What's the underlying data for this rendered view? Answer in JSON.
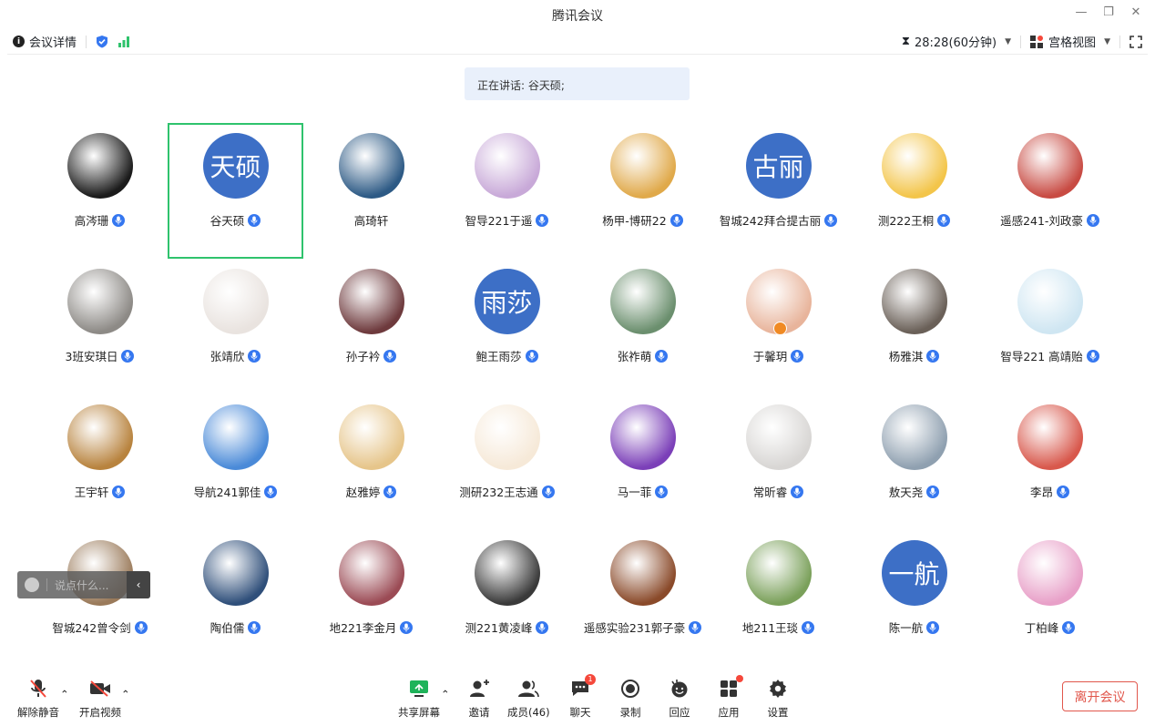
{
  "window": {
    "title": "腾讯会议"
  },
  "infobar": {
    "meeting_info": "会议详情",
    "timer": "28:28(60分钟)",
    "view": "宫格视图"
  },
  "speaking": "正在讲话: 谷天硕;",
  "participants": [
    {
      "name": "高涔珊",
      "bg": "#1b1b1b",
      "mic": true
    },
    {
      "name": "谷天硕",
      "avatar_text": "天硕",
      "mic": true,
      "active": true
    },
    {
      "name": "高琦轩",
      "bg": "#2d5a85",
      "mic": false
    },
    {
      "name": "智导221于遥",
      "bg": "#c8a9d8",
      "mic": true
    },
    {
      "name": "杨甲-博研22",
      "bg": "#e0a94a",
      "mic": true
    },
    {
      "name": "智城242拜合提古丽",
      "avatar_text": "古丽",
      "mic": true
    },
    {
      "name": "测222王桐",
      "bg": "#f3c54a",
      "mic": true
    },
    {
      "name": "遥感241-刘政豪",
      "bg": "#c84b43",
      "mic": true
    },
    {
      "name": "3班安琪日",
      "bg": "#8d8a86",
      "mic": true
    },
    {
      "name": "张靖欣",
      "bg": "#e9e3df",
      "mic": true
    },
    {
      "name": "孙子衿",
      "bg": "#6e3a3d",
      "mic": true
    },
    {
      "name": "鲍王雨莎",
      "avatar_text": "雨莎",
      "mic": true
    },
    {
      "name": "张祚萌",
      "bg": "#6b8f6e",
      "mic": true
    },
    {
      "name": "于馨玥",
      "bg": "#e8b49b",
      "mic": true,
      "host": true
    },
    {
      "name": "杨雅淇",
      "bg": "#6a6058",
      "mic": true
    },
    {
      "name": "智导221 高靖贻",
      "bg": "#cfe6f2",
      "mic": true
    },
    {
      "name": "王宇轩",
      "bg": "#b8833e",
      "mic": true
    },
    {
      "name": "导航241郭佳",
      "bg": "#4a8ad8",
      "mic": true
    },
    {
      "name": "赵雅婷",
      "bg": "#e6c58a",
      "mic": true
    },
    {
      "name": "测研232王志通",
      "bg": "#f6e9d8",
      "mic": true
    },
    {
      "name": "马一菲",
      "bg": "#7b3fb8",
      "mic": true
    },
    {
      "name": "常昕睿",
      "bg": "#d8d6d4",
      "mic": true
    },
    {
      "name": "敖天尧",
      "bg": "#8fa0b0",
      "mic": true
    },
    {
      "name": "李昂",
      "bg": "#d8584c",
      "mic": true
    },
    {
      "name": "智城242曾令剑",
      "bg": "#9a7a5a",
      "mic": true
    },
    {
      "name": "陶伯儒",
      "bg": "#2f4f7a",
      "mic": true
    },
    {
      "name": "地221李金月",
      "bg": "#9b4b55",
      "mic": true
    },
    {
      "name": "测221黄凌峰",
      "bg": "#3a3a3a",
      "mic": true
    },
    {
      "name": "遥感实验231郭子豪",
      "bg": "#8a4a2a",
      "mic": true
    },
    {
      "name": "地211王琰",
      "bg": "#7aa05a",
      "mic": true
    },
    {
      "name": "陈一航",
      "avatar_text": "一航",
      "mic": true
    },
    {
      "name": "丁柏峰",
      "bg": "#e8a0c8",
      "mic": true
    }
  ],
  "chat": {
    "placeholder": "说点什么..."
  },
  "toolbar": {
    "unmute": "解除静音",
    "video": "开启视频",
    "share": "共享屏幕",
    "invite": "邀请",
    "members": "成员(46)",
    "chat": "聊天",
    "chat_badge": "1",
    "record": "录制",
    "react": "回应",
    "apps": "应用",
    "settings": "设置",
    "leave": "离开会议"
  },
  "colors": {
    "accent": "#3577f0",
    "active_border": "#2fc36d",
    "leave": "#e1574c"
  }
}
